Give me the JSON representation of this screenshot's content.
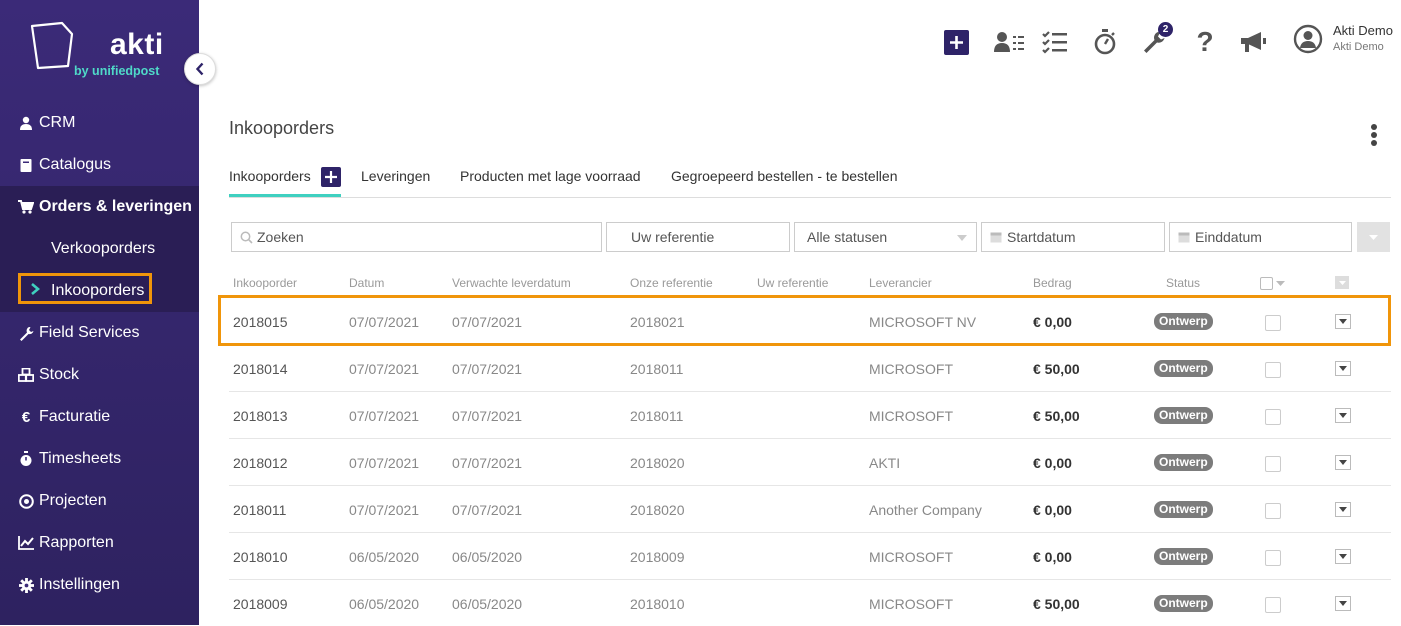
{
  "brand": {
    "name": "akti",
    "tagline": "by unifiedpost"
  },
  "sidebar": {
    "items": [
      {
        "label": "CRM",
        "icon": "user-icon"
      },
      {
        "label": "Catalogus",
        "icon": "book-icon"
      },
      {
        "label": "Orders & leveringen",
        "icon": "cart-icon"
      },
      {
        "label": "Verkooporders"
      },
      {
        "label": "Inkooporders"
      },
      {
        "label": "Field Services",
        "icon": "wrench-icon"
      },
      {
        "label": "Stock",
        "icon": "cubes-icon"
      },
      {
        "label": "Facturatie",
        "icon": "euro-icon"
      },
      {
        "label": "Timesheets",
        "icon": "stopwatch-icon"
      },
      {
        "label": "Projecten",
        "icon": "target-icon"
      },
      {
        "label": "Rapporten",
        "icon": "chart-icon"
      },
      {
        "label": "Instellingen",
        "icon": "gear-icon"
      }
    ]
  },
  "topbar": {
    "notification_count": "2",
    "user_name": "Akti Demo",
    "user_company": "Akti Demo"
  },
  "page": {
    "title": "Inkooporders"
  },
  "tabs": [
    {
      "label": "Inkooporders"
    },
    {
      "label": "Leveringen"
    },
    {
      "label": "Producten met lage voorraad"
    },
    {
      "label": "Gegroepeerd bestellen - te bestellen"
    }
  ],
  "filters": {
    "search_placeholder": "Zoeken",
    "reference_placeholder": "Uw referentie",
    "status_value": "Alle statusen",
    "start_placeholder": "Startdatum",
    "end_placeholder": "Einddatum"
  },
  "table": {
    "columns": [
      "Inkooporder",
      "Datum",
      "Verwachte leverdatum",
      "Onze referentie",
      "Uw referentie",
      "Leverancier",
      "Bedrag",
      "Status"
    ],
    "rows": [
      {
        "id": "2018015",
        "date": "07/07/2021",
        "expected": "07/07/2021",
        "our_ref": "2018021",
        "your_ref": "",
        "supplier": "MICROSOFT NV",
        "amount": "€ 0,00",
        "status": "Ontwerp"
      },
      {
        "id": "2018014",
        "date": "07/07/2021",
        "expected": "07/07/2021",
        "our_ref": "2018011",
        "your_ref": "",
        "supplier": "MICROSOFT",
        "amount": "€ 50,00",
        "status": "Ontwerp"
      },
      {
        "id": "2018013",
        "date": "07/07/2021",
        "expected": "07/07/2021",
        "our_ref": "2018011",
        "your_ref": "",
        "supplier": "MICROSOFT",
        "amount": "€ 50,00",
        "status": "Ontwerp"
      },
      {
        "id": "2018012",
        "date": "07/07/2021",
        "expected": "07/07/2021",
        "our_ref": "2018020",
        "your_ref": "",
        "supplier": "AKTI",
        "amount": "€ 0,00",
        "status": "Ontwerp"
      },
      {
        "id": "2018011",
        "date": "07/07/2021",
        "expected": "07/07/2021",
        "our_ref": "2018020",
        "your_ref": "",
        "supplier": "Another Company",
        "amount": "€ 0,00",
        "status": "Ontwerp"
      },
      {
        "id": "2018010",
        "date": "06/05/2020",
        "expected": "06/05/2020",
        "our_ref": "2018009",
        "your_ref": "",
        "supplier": "MICROSOFT",
        "amount": "€ 0,00",
        "status": "Ontwerp"
      },
      {
        "id": "2018009",
        "date": "06/05/2020",
        "expected": "06/05/2020",
        "our_ref": "2018010",
        "your_ref": "",
        "supplier": "MICROSOFT",
        "amount": "€ 50,00",
        "status": "Ontwerp"
      }
    ]
  },
  "colors": {
    "sidebar": "#3b2a78",
    "accent": "#3fd0c0",
    "highlight": "#f0950a",
    "brand_dark": "#2e2368"
  }
}
